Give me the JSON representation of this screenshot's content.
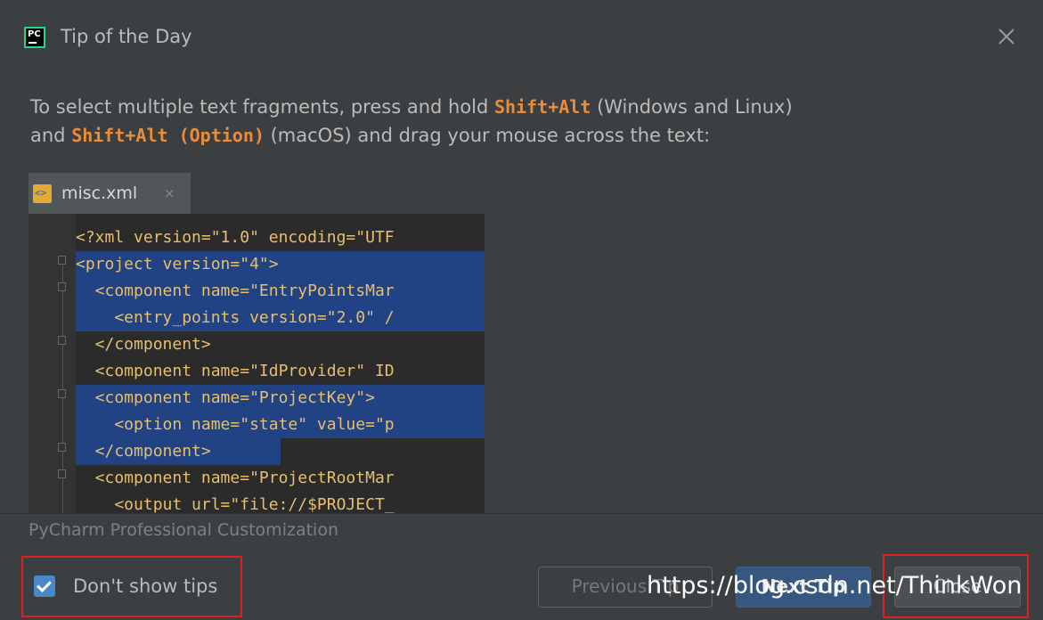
{
  "window": {
    "logo_text": "PC",
    "title": "Tip of the Day",
    "close_icon": "close-icon"
  },
  "tip": {
    "part1": "To select multiple text fragments, press and hold ",
    "key1": "Shift+Alt",
    "part2": " (Windows and Linux)",
    "part3": "and ",
    "key2": "Shift+Alt (Option)",
    "part4": " (macOS) and drag your mouse across the text:"
  },
  "editor": {
    "tab_name": "misc.xml",
    "tab_close": "×",
    "lines": [
      {
        "text": "<?xml version=\"1.0\" encoding=\"UTF"
      },
      {
        "text": "<project version=\"4\">"
      },
      {
        "text": "  <component name=\"EntryPointsMar"
      },
      {
        "text": "    <entry_points version=\"2.0\" /"
      },
      {
        "text": "  </component>"
      },
      {
        "text": "  <component name=\"IdProvider\" ID"
      },
      {
        "text": "  <component name=\"ProjectKey\">"
      },
      {
        "text": "    <option name=\"state\" value=\"p"
      },
      {
        "text": "  </component>"
      },
      {
        "text": "  <component name=\"ProjectRootMar"
      },
      {
        "text": "    <output url=\"file://$PROJECT_"
      }
    ]
  },
  "footer": {
    "customization": "PyCharm Professional Customization",
    "dont_show_label": "Don't show tips",
    "dont_show_checked": true,
    "previous_label": "Previous Tip",
    "next_label": "Next Tip",
    "close_label": "Close"
  },
  "watermark": "https://blog.csdn.net/ThinkWon",
  "colors": {
    "background": "#3c3f41",
    "key_highlight": "#e98d3a",
    "selection": "#214283",
    "primary_button": "#365880",
    "annotation_box": "#e02020"
  }
}
